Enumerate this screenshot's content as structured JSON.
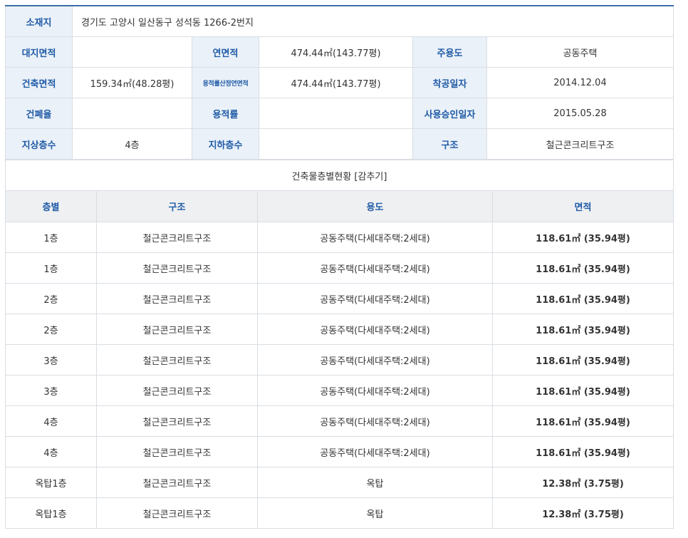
{
  "info": {
    "address_label": "소재지",
    "address_value": "경기도 고양시 일산동구 성석동 1266-2번지",
    "rows": [
      [
        {
          "label": "대지면적",
          "value": ""
        },
        {
          "label": "연면적",
          "value": "474.44㎡(143.77평)"
        },
        {
          "label": "주용도",
          "value": "공동주택"
        }
      ],
      [
        {
          "label": "건축면적",
          "value": "159.34㎡(48.28평)"
        },
        {
          "label": "용적률산정연면적",
          "value": "474.44㎡(143.77평)"
        },
        {
          "label": "착공일자",
          "value": "2014.12.04"
        }
      ],
      [
        {
          "label": "건폐율",
          "value": ""
        },
        {
          "label": "용적률",
          "value": ""
        },
        {
          "label": "사용승인일자",
          "value": "2015.05.28"
        }
      ],
      [
        {
          "label": "지상층수",
          "value": "4층"
        },
        {
          "label": "지하층수",
          "value": ""
        },
        {
          "label": "구조",
          "value": "철근콘크리트구조"
        }
      ]
    ]
  },
  "floors": {
    "title": "건축물층별현황 [감추기]",
    "headers": [
      "층별",
      "구조",
      "용도",
      "면적"
    ],
    "rows": [
      [
        "1층",
        "철근콘크리트구조",
        "공동주택(다세대주택:2세대)",
        "118.61㎡ (35.94평)"
      ],
      [
        "1층",
        "철근콘크리트구조",
        "공동주택(다세대주택:2세대)",
        "118.61㎡ (35.94평)"
      ],
      [
        "2층",
        "철근콘크리트구조",
        "공동주택(다세대주택:2세대)",
        "118.61㎡ (35.94평)"
      ],
      [
        "2층",
        "철근콘크리트구조",
        "공동주택(다세대주택:2세대)",
        "118.61㎡ (35.94평)"
      ],
      [
        "3층",
        "철근콘크리트구조",
        "공동주택(다세대주택:2세대)",
        "118.61㎡ (35.94평)"
      ],
      [
        "3층",
        "철근콘크리트구조",
        "공동주택(다세대주택:2세대)",
        "118.61㎡ (35.94평)"
      ],
      [
        "4층",
        "철근콘크리트구조",
        "공동주택(다세대주택:2세대)",
        "118.61㎡ (35.94평)"
      ],
      [
        "4층",
        "철근콘크리트구조",
        "공동주택(다세대주택:2세대)",
        "118.61㎡ (35.94평)"
      ],
      [
        "옥탑1층",
        "철근콘크리트구조",
        "옥탑",
        "12.38㎡ (3.75평)"
      ],
      [
        "옥탑1층",
        "철근콘크리트구조",
        "옥탑",
        "12.38㎡ (3.75평)"
      ]
    ]
  }
}
